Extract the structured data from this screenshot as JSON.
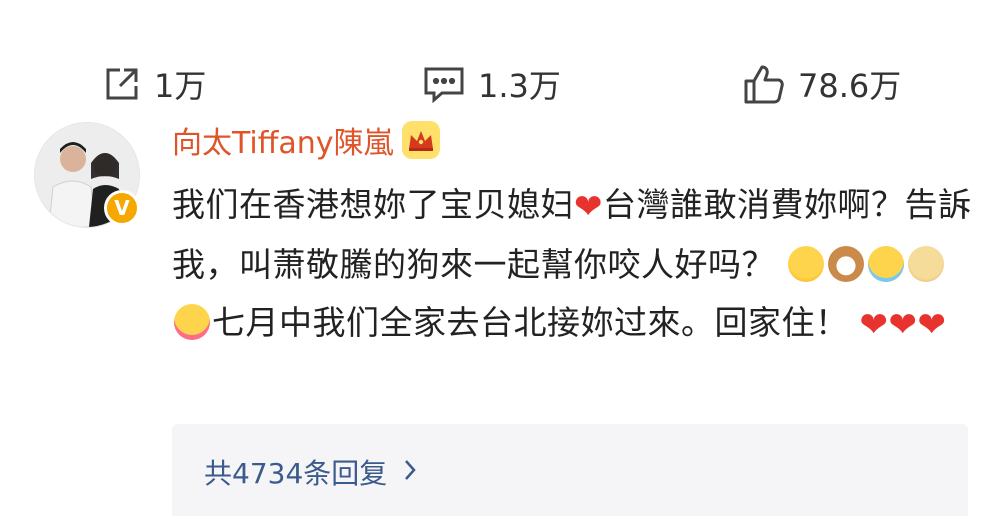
{
  "actions": {
    "repost": {
      "icon": "repost-icon",
      "count": "1万"
    },
    "comment": {
      "icon": "comment-icon",
      "count": "1.3万"
    },
    "like": {
      "icon": "thumbs-up-icon",
      "count": "78.6万"
    }
  },
  "comment": {
    "username": "向太Tiffany陳嵐",
    "badge": "crown-icon",
    "verified_badge": "V",
    "text": {
      "seg1": "我们在香港想妳了宝贝媳妇",
      "seg2": "台灣誰敢消費妳啊？告訴我，叫萧敬騰的狗來一起幫你咬人好吗？",
      "seg3": "七月中我们全家去台北接妳过來。回家住！"
    },
    "emojis": [
      "laughing-emoji",
      "dog-emoji",
      "tears-of-joy-emoji",
      "doge-emoji",
      "tongue-wink-emoji"
    ],
    "accent_color": "#e0542a",
    "heart_color": "#e8322e"
  },
  "replies": {
    "label": "共4734条回复",
    "chevron": "chevron-right-icon",
    "link_color": "#3a5b8c"
  }
}
